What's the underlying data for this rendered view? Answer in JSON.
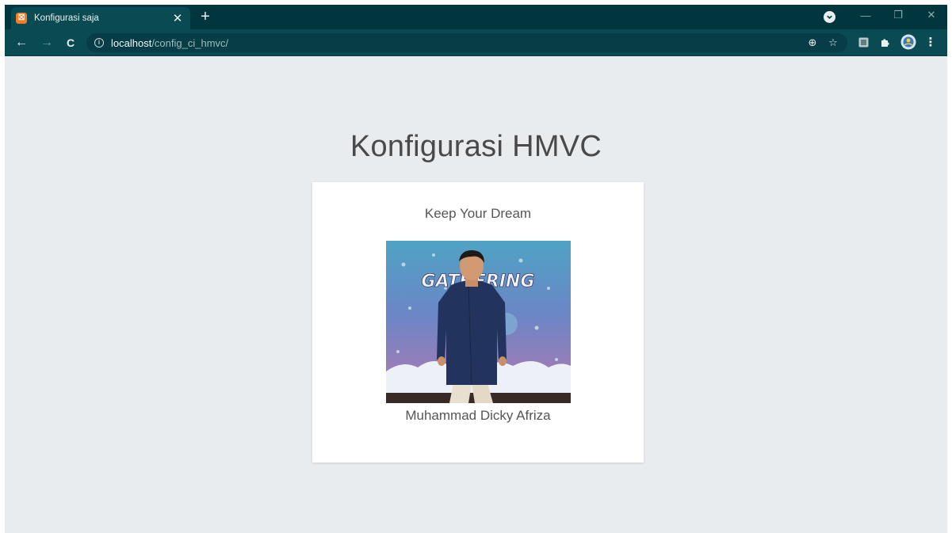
{
  "browser": {
    "tab": {
      "title": "Konfigurasi saja",
      "favicon_glyph": "⛝",
      "close_glyph": "✕"
    },
    "new_tab_glyph": "+",
    "window_controls": {
      "minimize": "—",
      "restore": "❐",
      "close": "✕"
    },
    "nav": {
      "back": "←",
      "forward": "→",
      "reload": "C"
    },
    "address": {
      "info": "i",
      "host": "localhost",
      "path": "/config_ci_hmvc/"
    },
    "toolbar_icons": {
      "zoom": "⊕",
      "bookmark": "☆",
      "menu": "⋮"
    },
    "colors": {
      "tabstrip": "#01363f",
      "toolbar": "#0a4a52",
      "accent_favicon": "#f57b25"
    }
  },
  "page": {
    "title": "Konfigurasi HMVC",
    "card": {
      "subtitle": "Keep Your Dream",
      "photo_text": "GATHERING",
      "caption": "Muhammad Dicky Afriza"
    },
    "background": "#e9ecef"
  }
}
